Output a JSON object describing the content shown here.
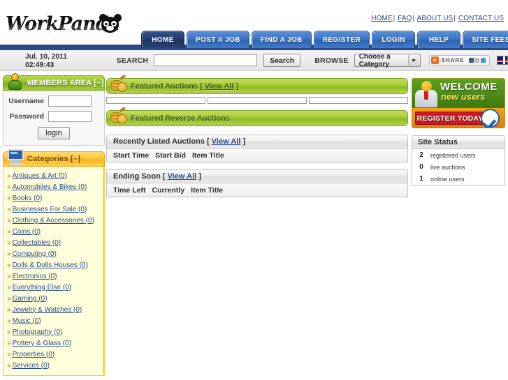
{
  "top_links": [
    {
      "label": "HOME"
    },
    {
      "label": "FAQ"
    },
    {
      "label": "ABOUT US"
    },
    {
      "label": "CONTACT US"
    }
  ],
  "logo": {
    "text": "WorkPanda",
    "icon": "panda-icon"
  },
  "nav_tabs": [
    {
      "label": "HOME",
      "active": true
    },
    {
      "label": "POST A JOB",
      "active": false
    },
    {
      "label": "FIND A JOB",
      "active": false
    },
    {
      "label": "REGISTER",
      "active": false
    },
    {
      "label": "LOGIN",
      "active": false
    },
    {
      "label": "HELP",
      "active": false
    },
    {
      "label": "SITE FEES",
      "active": false
    }
  ],
  "subbar": {
    "datetime": "Jul. 10, 2011 02:49:43",
    "search_label": "SEARCH",
    "search_value": "",
    "search_placeholder": "",
    "search_button": "Search",
    "browse_label": "BROWSE",
    "category_selected": "Choose a Category",
    "share_label": "SHARE",
    "flag": "uk-flag-icon"
  },
  "members": {
    "title": "MEMBERS AREA [–]",
    "icon": "member-person-icon",
    "username_label": "Username",
    "username_value": "",
    "password_label": "Password",
    "password_value": "",
    "login_button": "login"
  },
  "categories": {
    "title": "Categories [–]",
    "icon": "monitor-icon",
    "items": [
      {
        "label": "Antiques & Art (0)"
      },
      {
        "label": "Automobiles & Bikes (0)"
      },
      {
        "label": "Books (0)"
      },
      {
        "label": "Businesses For Sale (0)"
      },
      {
        "label": "Clothing & Accessories (0)"
      },
      {
        "label": "Coins (0)"
      },
      {
        "label": "Collectables (0)"
      },
      {
        "label": "Computing (0)"
      },
      {
        "label": "Dolls & Dolls Houses (0)"
      },
      {
        "label": "Electronics (0)"
      },
      {
        "label": "Everything Else (0)"
      },
      {
        "label": "Gaming (0)"
      },
      {
        "label": "Jewelry & Watches (0)"
      },
      {
        "label": "Music (0)"
      },
      {
        "label": "Photography (0)"
      },
      {
        "label": "Pottery & Glass (0)"
      },
      {
        "label": "Properties (0)"
      },
      {
        "label": "Services (0)"
      }
    ]
  },
  "main": {
    "featured_auctions": {
      "title": "Featured Auctions [",
      "view_all": "View All",
      "title_end": "]",
      "icon": "coins-icon",
      "boxes": 3
    },
    "featured_reverse": {
      "title": "Featured Reverse Auctions",
      "icon": "coins-icon"
    },
    "recently_listed": {
      "title": "Recently Listed Auctions [",
      "view_all": "View All",
      "title_end": "]",
      "columns": [
        "Start Time",
        "Start Bid",
        "Item Title"
      ],
      "rows": []
    },
    "ending_soon": {
      "title": "Ending Soon [",
      "view_all": "View All",
      "title_end": "]",
      "columns": [
        "Time Left",
        "Currently",
        "Item Title"
      ],
      "rows": []
    }
  },
  "right": {
    "banner": {
      "line1": "WELCOME",
      "line2": "new users",
      "cta": "REGISTER TODAY",
      "check_icon": "blue-check-icon",
      "person_icon": "new-user-icon"
    },
    "site_status": {
      "title": "Site Status",
      "rows": [
        {
          "count": "2",
          "label": "registered users"
        },
        {
          "count": "0",
          "label": "live auctions"
        },
        {
          "count": "1",
          "label": "online users"
        }
      ]
    }
  },
  "colors": {
    "nav_blue": "#2f63b4",
    "nav_active_blue": "#22396a",
    "panel_green": "#a5cb36",
    "panel_yellow": "#ffc73d",
    "link_blue": "#2a4b8d",
    "banner_orange": "#e07c0c",
    "banner_red": "#cc1a20",
    "sidebar_cream": "#ffffdc"
  }
}
